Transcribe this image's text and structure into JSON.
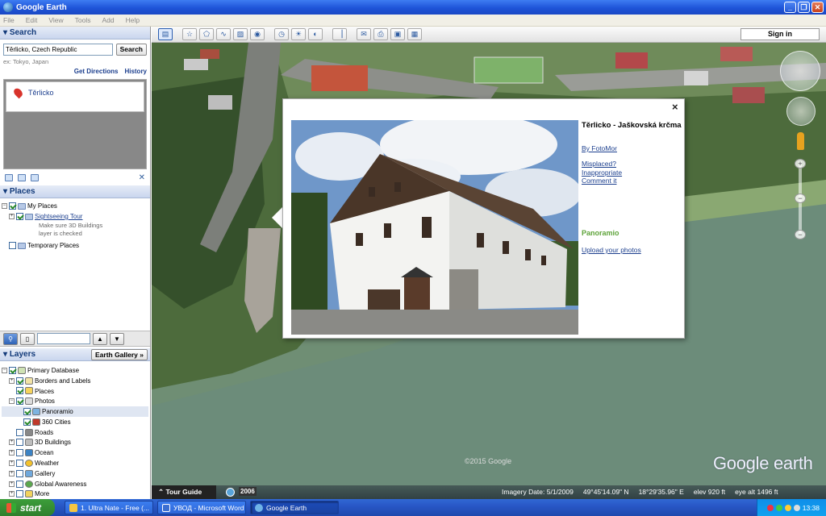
{
  "window": {
    "title": "Google Earth"
  },
  "menu": [
    "File",
    "Edit",
    "View",
    "Tools",
    "Add",
    "Help"
  ],
  "search": {
    "header": "Search",
    "query": "Těrlicko, Czech Republic",
    "button": "Search",
    "hint": "ex: Tokyo, Japan",
    "get_directions": "Get Directions",
    "history": "History",
    "result": "Těrlicko"
  },
  "places": {
    "header": "Places",
    "my_places": "My Places",
    "tour": "Sightseeing Tour",
    "tour_note1": "Make sure 3D Buildings",
    "tour_note2": "layer is checked",
    "temporary": "Temporary Places"
  },
  "layers": {
    "header": "Layers",
    "gallery_button": "Earth Gallery",
    "items": [
      {
        "label": "Primary Database",
        "checked": true
      },
      {
        "label": "Borders and Labels",
        "checked": true
      },
      {
        "label": "Places",
        "checked": true
      },
      {
        "label": "Photos",
        "checked": true
      },
      {
        "label": "Panoramio",
        "checked": true
      },
      {
        "label": "360 Cities",
        "checked": true
      },
      {
        "label": "Roads",
        "checked": false
      },
      {
        "label": "3D Buildings",
        "checked": false
      },
      {
        "label": "Ocean",
        "checked": false
      },
      {
        "label": "Weather",
        "checked": false
      },
      {
        "label": "Gallery",
        "checked": false
      },
      {
        "label": "Global Awareness",
        "checked": false
      },
      {
        "label": "More",
        "checked": false
      }
    ]
  },
  "toolbar": {
    "sign_in": "Sign in"
  },
  "popup": {
    "title": "Těrlicko - Jaškovská krčma",
    "author": "By FotoMor",
    "misplaced": "Misplaced?",
    "inappropriate": "Inappropriate",
    "comment": "Comment it",
    "brand": "Panoramio",
    "upload": "Upload your photos",
    "close": "×"
  },
  "map": {
    "copyright": "©2015 Google",
    "logo": "Google earth",
    "tour_guide": "Tour Guide",
    "year": "2006",
    "imagery_date": "Imagery Date: 5/1/2009",
    "lat": "49°45'14.09\" N",
    "lon": "18°29'35.96\" E",
    "elev": "elev   920 ft",
    "eye_alt": "eye alt  1496 ft"
  },
  "taskbar": {
    "start": "start",
    "tasks": [
      "1. Ultra Nate - Free (...",
      "УВОД - Microsoft Word",
      "Google Earth"
    ],
    "clock": "13:38"
  }
}
